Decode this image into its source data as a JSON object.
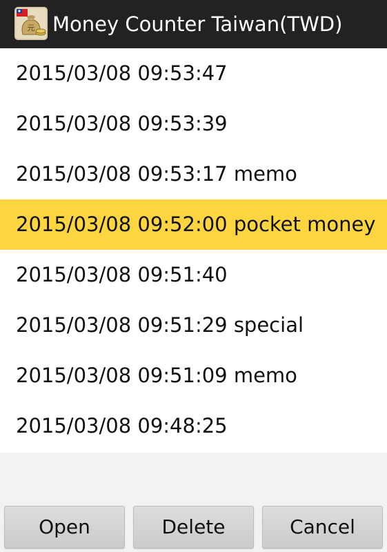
{
  "window": {
    "title": "Money Counter Taiwan(TWD)",
    "icon": "money-bag-app-icon"
  },
  "records": [
    {
      "text": "2015/03/08 09:53:47",
      "selected": false
    },
    {
      "text": "2015/03/08 09:53:39",
      "selected": false
    },
    {
      "text": "2015/03/08 09:53:17 memo",
      "selected": false
    },
    {
      "text": "2015/03/08 09:52:00 pocket money",
      "selected": true
    },
    {
      "text": "2015/03/08 09:51:40",
      "selected": false
    },
    {
      "text": "2015/03/08 09:51:29 special",
      "selected": false
    },
    {
      "text": "2015/03/08 09:51:09 memo",
      "selected": false
    },
    {
      "text": "2015/03/08 09:48:25",
      "selected": false
    }
  ],
  "buttons": {
    "open": "Open",
    "delete": "Delete",
    "cancel": "Cancel"
  },
  "colors": {
    "titlebar": "#222222",
    "selection": "#fdd541",
    "list_background": "#ffffff"
  }
}
